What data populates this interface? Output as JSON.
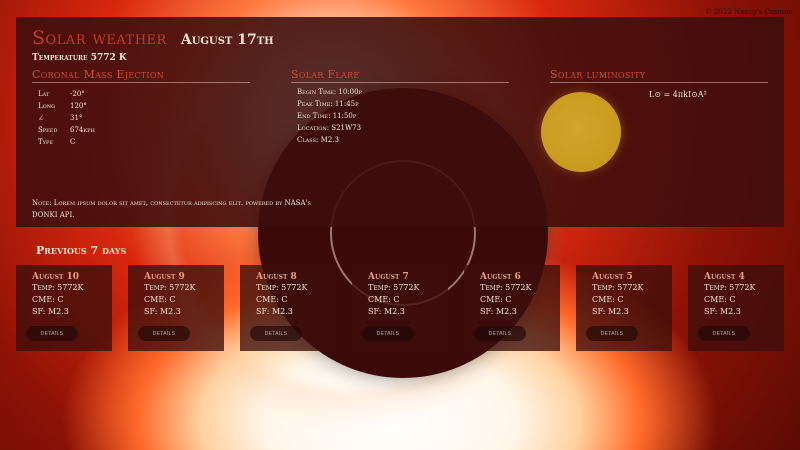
{
  "copyright": "© 2022 Nancy's Cosmos",
  "header": {
    "title": "Solar weather",
    "date": "August 17th",
    "temperature": "Temperature 5772 K"
  },
  "cme": {
    "heading": "Coronal Mass Ejection",
    "rows": [
      {
        "key": "Lat",
        "value": "-20°"
      },
      {
        "key": "Long",
        "value": "120°"
      },
      {
        "key": "∠",
        "value": "31°"
      },
      {
        "key": "Speed",
        "value": "674kph"
      },
      {
        "key": "Type",
        "value": "C"
      }
    ]
  },
  "flare": {
    "heading": "Solar Flare",
    "lines": [
      "Begin Time: 10:00p",
      "Peak Time: 11:45p",
      "End Time: 11:50p",
      "Location: S21W73",
      "Class: M2.3"
    ]
  },
  "luminosity": {
    "heading": "Solar luminosity",
    "formula": "L⊙ = 4πkI⊙A²"
  },
  "note": "Note: Lorem ipsum dolor sit amet, consectetur adipiscing elit. powered by NASA's DONKI API.",
  "previous": {
    "heading": "Previous 7 days",
    "cards": [
      {
        "date": "August 10",
        "temp": "Temp: 5772K",
        "cme": "CME: C",
        "sf": "SF: M2.3",
        "button": "DETAILS"
      },
      {
        "date": "August 9",
        "temp": "Temp: 5772K",
        "cme": "CME: C",
        "sf": "SF: M2.3",
        "button": "DETAILS"
      },
      {
        "date": "August 8",
        "temp": "Temp: 5772K",
        "cme": "CME: C",
        "sf": "SF: M2.3",
        "button": "DETAILS"
      },
      {
        "date": "August 7",
        "temp": "Temp: 5772K",
        "cme": "CME: C",
        "sf": "SF: M2.3",
        "button": "DETAILS"
      },
      {
        "date": "August 6",
        "temp": "Temp: 5772K",
        "cme": "CME: C",
        "sf": "SF: M2.3",
        "button": "DETAILS"
      },
      {
        "date": "August 5",
        "temp": "Temp: 5772K",
        "cme": "CME: C",
        "sf": "SF: M2.3",
        "button": "DETAILS"
      },
      {
        "date": "August 4",
        "temp": "Temp: 5772K",
        "cme": "CME: C",
        "sf": "SF: M2.3",
        "button": "DETAILS"
      }
    ]
  },
  "colors": {
    "accent_red": "#c43a26",
    "panel": "#3e0e0c",
    "sun_disc": "#c99a1e"
  }
}
